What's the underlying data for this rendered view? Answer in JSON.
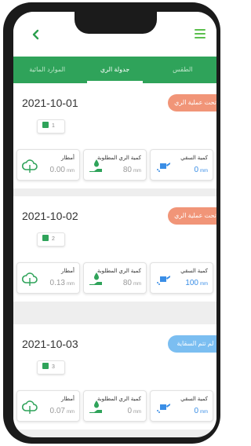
{
  "topbar": {
    "back_icon": "chevron-left-icon",
    "menu_icon": "hamburger-icon"
  },
  "tabs": [
    {
      "label": "الموارد المائية",
      "active": false
    },
    {
      "label": "جدولة الري",
      "active": true
    },
    {
      "label": "الطقس",
      "active": false
    }
  ],
  "cards": [
    {
      "date": "2021-10-01",
      "badge": "تحت عملية الري",
      "badge_color": "#f08a6a",
      "day": "1",
      "stats": [
        {
          "label": "أمطار",
          "value": "0.00",
          "unit": "mm",
          "icon": "cloud-icon"
        },
        {
          "label": "كمية الري المطلوبة",
          "value": "80",
          "unit": "mm",
          "icon": "hand-water-drop-icon"
        },
        {
          "label": "كمية السقي",
          "value": "0",
          "unit": "mm",
          "icon": "watering-can-icon"
        }
      ]
    },
    {
      "date": "2021-10-02",
      "badge": "تحت عملية الري",
      "badge_color": "#f08a6a",
      "day": "2",
      "stats": [
        {
          "label": "أمطار",
          "value": "0.13",
          "unit": "mm",
          "icon": "cloud-icon"
        },
        {
          "label": "كمية الري المطلوبة",
          "value": "80",
          "unit": "mm",
          "icon": "hand-water-drop-icon"
        },
        {
          "label": "كمية السقي",
          "value": "100",
          "unit": "mm",
          "icon": "watering-can-icon"
        }
      ]
    },
    {
      "date": "2021-10-03",
      "badge": "لم تتم السقاية",
      "badge_color": "#6db8f0",
      "day": "3",
      "stats": [
        {
          "label": "أمطار",
          "value": "0.07",
          "unit": "mm",
          "icon": "cloud-icon"
        },
        {
          "label": "كمية الري المطلوبة",
          "value": "0",
          "unit": "mm",
          "icon": "hand-water-drop-icon"
        },
        {
          "label": "كمية السقي",
          "value": "0",
          "unit": "mm",
          "icon": "watering-can-icon"
        }
      ]
    }
  ],
  "colors": {
    "primary_green": "#2fa35a",
    "accent_green": "#5bbf4d",
    "value_blue": "#3a8ee6"
  }
}
